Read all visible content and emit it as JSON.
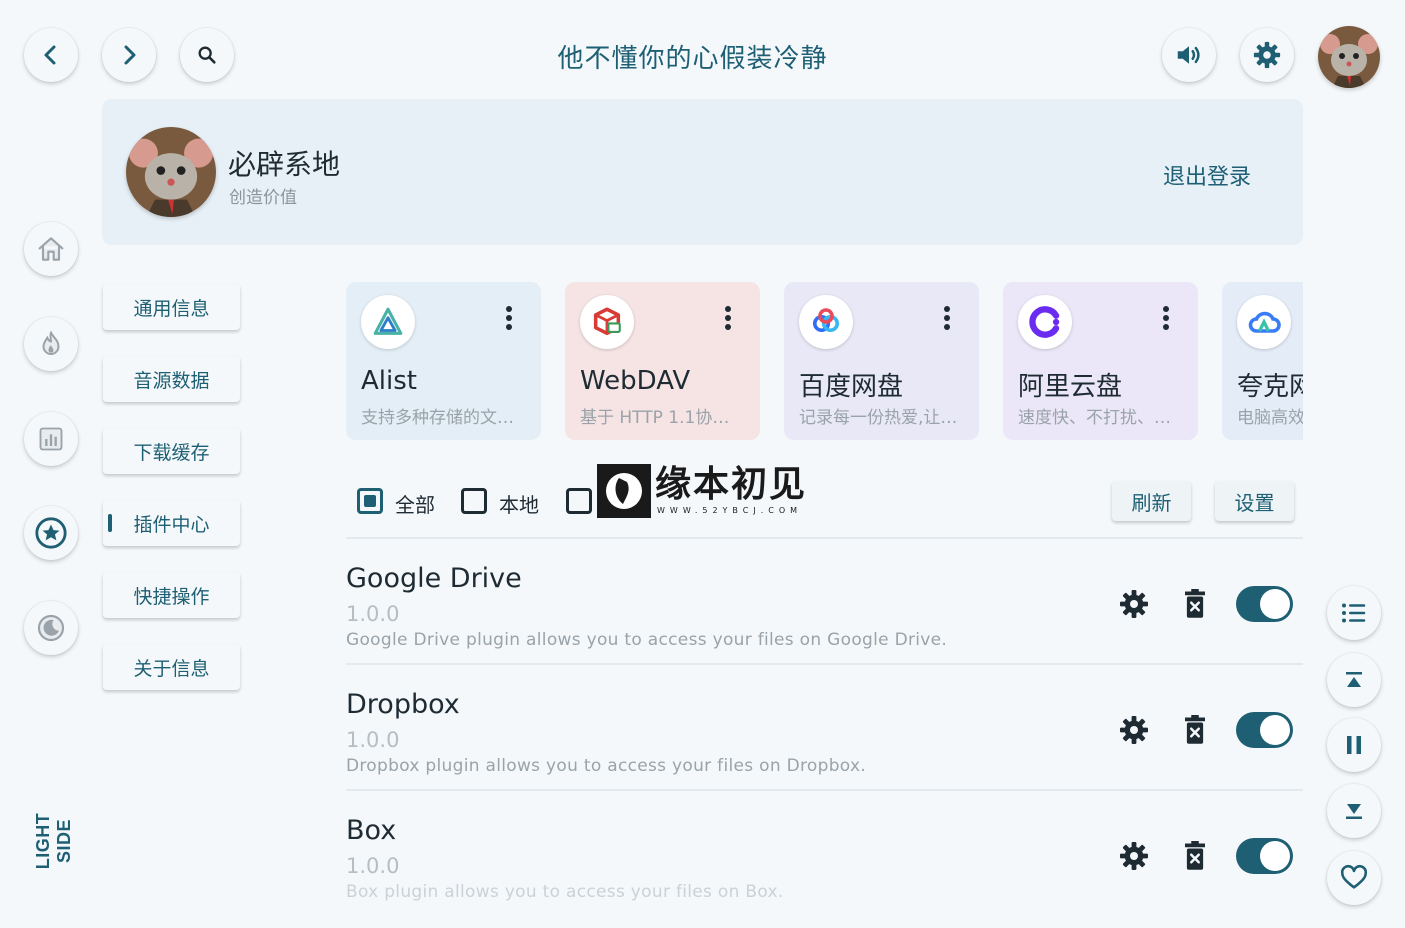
{
  "header": {
    "title": "他不懂你的心假装冷静",
    "back_icon": "chevron-left-icon",
    "forward_icon": "chevron-right-icon",
    "search_icon": "search-icon",
    "volume_icon": "volume-icon",
    "settings_icon": "gear-icon"
  },
  "profile": {
    "name": "必辟系地",
    "subtitle": "创造价值",
    "logout_label": "退出登录"
  },
  "side_nav": {
    "items": [
      "home-icon",
      "fire-icon",
      "chart-icon",
      "star-icon",
      "moon-icon"
    ],
    "theme_label": "LIGHT SIDE"
  },
  "menu": {
    "items": [
      {
        "label": "通用信息",
        "active": false
      },
      {
        "label": "音源数据",
        "active": false
      },
      {
        "label": "下载缓存",
        "active": false
      },
      {
        "label": "插件中心",
        "active": true
      },
      {
        "label": "快捷操作",
        "active": false
      },
      {
        "label": "关于信息",
        "active": false
      }
    ]
  },
  "sources": [
    {
      "name": "Alist",
      "desc": "支持多种存储的文…",
      "bg": "#e3eef6"
    },
    {
      "name": "WebDAV",
      "desc": "基于 HTTP 1.1协…",
      "bg": "#f6e4e4"
    },
    {
      "name": "百度网盘",
      "desc": "记录每一份热爱,让…",
      "bg": "#e8e8f7"
    },
    {
      "name": "阿里云盘",
      "desc": "速度快、不打扰、…",
      "bg": "#ebe7f8"
    },
    {
      "name": "夸克网盘",
      "desc": "电脑高效",
      "bg": "#e4ecf8"
    }
  ],
  "filters": {
    "all_label": "全部",
    "local_label": "本地",
    "refresh_label": "刷新",
    "settings_label": "设置"
  },
  "watermark": {
    "text": "缘本初见",
    "url": "WWW.52YBCJ.COM"
  },
  "plugins": [
    {
      "name": "Google Drive",
      "version": "1.0.0",
      "desc": "Google Drive plugin allows you to access your files on Google Drive.",
      "enabled": true
    },
    {
      "name": "Dropbox",
      "version": "1.0.0",
      "desc": "Dropbox plugin allows you to access your files on Dropbox.",
      "enabled": true
    },
    {
      "name": "Box",
      "version": "1.0.0",
      "desc": "Box plugin allows you to access your files on Box.",
      "enabled": true
    }
  ],
  "right_rail": [
    "list-icon",
    "scroll-top-icon",
    "pause-icon",
    "scroll-bottom-icon",
    "heart-icon"
  ],
  "colors": {
    "accent": "#1e5f74",
    "background": "#f4f8fb"
  }
}
